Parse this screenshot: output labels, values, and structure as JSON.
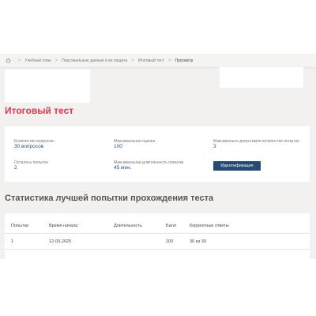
{
  "breadcrumb": {
    "items": [
      "Учебный план",
      "Персональные данные и их защита",
      "Итоговый тест",
      "Просмотр"
    ],
    "separator": ">"
  },
  "page": {
    "title": "Итоговый тест"
  },
  "info": {
    "questions_label": "Количество вопросов",
    "questions_value": "30 вопросов",
    "max_score_label": "Максимальная оценка",
    "max_score_value": "100",
    "max_attempts_label": "Максимально допустимое количество попыток",
    "max_attempts_value": "3",
    "remaining_label": "Осталось попыток",
    "remaining_value": "2",
    "max_duration_label": "Максимальная длительность попытки",
    "max_duration_value": "45 мин.",
    "ident_button": "Идентификация"
  },
  "stats": {
    "title": "Статистика лучшей попытки прохождения теста",
    "columns": [
      "Попытки",
      "Время начала",
      "Длительность",
      "Балл",
      "Корректные ответы"
    ],
    "rows": [
      [
        "1",
        "12-03-2025",
        "",
        "100",
        "30 из 30"
      ]
    ]
  },
  "colors": {
    "title_accent": "#e8354a",
    "value_text": "#2a4f7c",
    "button_bg": "#244b77",
    "page_bg": "#f2f1ef"
  }
}
